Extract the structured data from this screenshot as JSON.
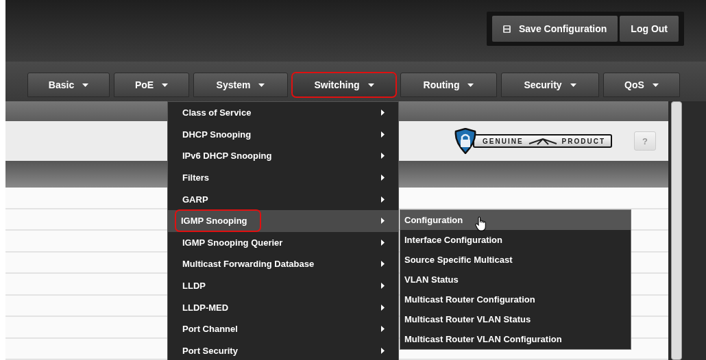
{
  "header": {
    "buttons": [
      {
        "kind": "save",
        "label": "Save Configuration"
      },
      {
        "kind": "logout",
        "label": "Log Out"
      }
    ]
  },
  "nav": {
    "tabs": [
      {
        "label": "Basic",
        "selected": false,
        "annotated": false
      },
      {
        "label": "PoE",
        "selected": false,
        "annotated": false
      },
      {
        "label": "System",
        "selected": false,
        "annotated": false
      },
      {
        "label": "Switching",
        "selected": true,
        "annotated": true
      },
      {
        "label": "Routing",
        "selected": false,
        "annotated": false
      },
      {
        "label": "Security",
        "selected": false,
        "annotated": false
      },
      {
        "label": "QoS",
        "selected": false,
        "annotated": false
      }
    ]
  },
  "badge": {
    "left": "GENUINE",
    "right": "PRODUCT"
  },
  "help_button": "?",
  "menu": {
    "items": [
      {
        "label": "Class of Service",
        "selected": false,
        "annotated": false
      },
      {
        "label": "DHCP Snooping",
        "selected": false,
        "annotated": false
      },
      {
        "label": "IPv6 DHCP Snooping",
        "selected": false,
        "annotated": false
      },
      {
        "label": "Filters",
        "selected": false,
        "annotated": false
      },
      {
        "label": "GARP",
        "selected": false,
        "annotated": false
      },
      {
        "label": "IGMP Snooping",
        "selected": true,
        "annotated": true
      },
      {
        "label": "IGMP Snooping Querier",
        "selected": false,
        "annotated": false
      },
      {
        "label": "Multicast Forwarding Database",
        "selected": false,
        "annotated": false
      },
      {
        "label": "LLDP",
        "selected": false,
        "annotated": false
      },
      {
        "label": "LLDP-MED",
        "selected": false,
        "annotated": false
      },
      {
        "label": "Port Channel",
        "selected": false,
        "annotated": false
      },
      {
        "label": "Port Security",
        "selected": false,
        "annotated": false
      }
    ]
  },
  "submenu": {
    "items": [
      {
        "label": "Configuration",
        "selected": true
      },
      {
        "label": "Interface Configuration",
        "selected": false
      },
      {
        "label": "Source Specific Multicast",
        "selected": false
      },
      {
        "label": "VLAN Status",
        "selected": false
      },
      {
        "label": "Multicast Router Configuration",
        "selected": false
      },
      {
        "label": "Multicast Router VLAN Status",
        "selected": false
      },
      {
        "label": "Multicast Router VLAN Configuration",
        "selected": false
      }
    ]
  }
}
